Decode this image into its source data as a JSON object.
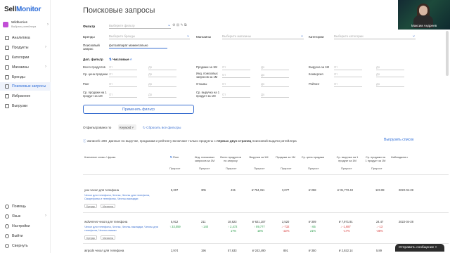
{
  "brand": {
    "logo_part1": "Sell",
    "logo_part2": "Monitor"
  },
  "account": {
    "name": "Wildberries",
    "sub": "Выбрать ритейлера"
  },
  "sidebar": {
    "items": [
      {
        "label": "Аналитика"
      },
      {
        "label": "Продукты"
      },
      {
        "label": "Категории"
      },
      {
        "label": "Магазины"
      },
      {
        "label": "Бренды"
      },
      {
        "label": "Поисковые запросы"
      },
      {
        "label": "Избранное"
      },
      {
        "label": "Выгрузки"
      }
    ],
    "bottom": [
      {
        "label": "Помощь"
      },
      {
        "label": "Язык"
      },
      {
        "label": "Настройки"
      },
      {
        "label": "Выйти"
      },
      {
        "label": "Свернуть"
      }
    ]
  },
  "page": {
    "title": "Поисковые запросы"
  },
  "filters": {
    "filter_label": "Фильтр",
    "filter_placeholder": "Выберите фильтр",
    "brands_label": "Бренды",
    "brands_placeholder": "Выберите бренды",
    "shops_label": "Магазины",
    "shops_placeholder": "Выберите магазины",
    "categories_label": "Категории",
    "categories_placeholder": "Выберите категории",
    "query_label": "Поисковый запрос",
    "query_value": "фотоаппарат моментально",
    "extra_label": "Доп. фильтр",
    "numeric_label": "Числовые",
    "from": "От",
    "to": "До",
    "numeric": [
      {
        "label": "Всего продуктов"
      },
      {
        "label": "Продажи за 1М"
      },
      {
        "label": "Выручка за 1М"
      },
      {
        "label": "Ср. цена продажи"
      },
      {
        "label": "Инд. поисковых запросов за 1М"
      },
      {
        "label": "Конверсия"
      },
      {
        "label": "Ранг"
      },
      {
        "label": "Отзывы"
      },
      {
        "label": "Рейтинг"
      },
      {
        "label": "Ср. продажи на 1 продукт за 1М"
      },
      {
        "label": "Ср. выручка на 1 продукт за 1М"
      }
    ],
    "apply": "Применить фильтр",
    "sort_label": "Отфильтровано по",
    "sort_value": "Keyword",
    "reset": "Сбросить все фильтры"
  },
  "results": {
    "notice_prefix": "Записей:",
    "count": "298",
    "notice_text": "Данные по выручке, продажам и рейтингу включают только продукты с",
    "notice_bold": "первых двух страниц",
    "notice_suffix": "поисковой выдачи ритейлера",
    "export": "Выгрузить список"
  },
  "table": {
    "headers": [
      "Ключевое слово / фраза",
      "Ранг",
      "Инд. поисковых запросов за 1М",
      "Всего продуктов по запросу",
      "Выручка за 1М",
      "Продажи за 1М",
      "Ср. цена продажи",
      "Ср. выручка на 1 продукт за 1М",
      "Ср. продажи на 1 продукт за 1М",
      "Наблюдаем с"
    ],
    "subheader": "Прирост",
    "rows": [
      {
        "keyword": "уни чехол для телефона",
        "links": "Чехол для телефона, Чехлы, Чехлы для телефона, Смартфоны и телефоны, Чехлы-накладки",
        "tag1": "Бренды",
        "tag2": "Магазины",
        "rank": "5,307",
        "idx": "305",
        "products": "415",
        "revenue": "₽ 794,311",
        "sales": "3,077",
        "price": "₽ 258",
        "avg_rev": "₽ 31,772.43",
        "avg_sales": "123.08",
        "since": "2022-04-28"
      },
      {
        "keyword": "wolverevs чехол для телефона",
        "links": "Чехол для телефона, Чехлы, Чехлы-накладки, Чехлы для телефона, Чехлы-книжки",
        "tag1": "Бренды",
        "tag2": "Магазины",
        "rank": "5,912",
        "rank_delta": "↑ 33,059",
        "idx": "211",
        "idx_delta": "↑ 140",
        "products": "18,623",
        "products_delta": "↑ 2,472",
        "products_pct": "17%",
        "revenue": "₽ 621,107",
        "revenue_delta": "↑ 89,777",
        "revenue_pct": "15%",
        "sales": "2,520",
        "sales_delta": "↓ -732",
        "sales_pct": "-22%",
        "price": "₽ 309",
        "price_delta": "↑ 65",
        "price_pct": "21%",
        "avg_rev": "₽ 7,971.91",
        "avg_rev_delta": "↓ -1,687",
        "avg_rev_pct": "-17%",
        "avg_sales": "24.47",
        "avg_sales_delta": "↓ -13",
        "avg_sales_pct": "-35%",
        "since": "2022-04-28"
      },
      {
        "keyword": "airpods чехол для телефона",
        "rank": "2,974",
        "idx": "196",
        "products": "57,633",
        "revenue": "₽ 243,490",
        "sales": "891",
        "price": "₽ 350",
        "avg_rev": "₽ 2,922.14",
        "avg_sales": "5.89",
        "since": "2022-04-28"
      }
    ]
  },
  "video": {
    "name": "Максим Андреев"
  },
  "chat": {
    "label": "Отправить сообщение"
  },
  "colors": {
    "accent": "#2c6cd8",
    "green": "#2a9d4b",
    "red": "#d83a3a",
    "purple": "#c24ed6"
  }
}
